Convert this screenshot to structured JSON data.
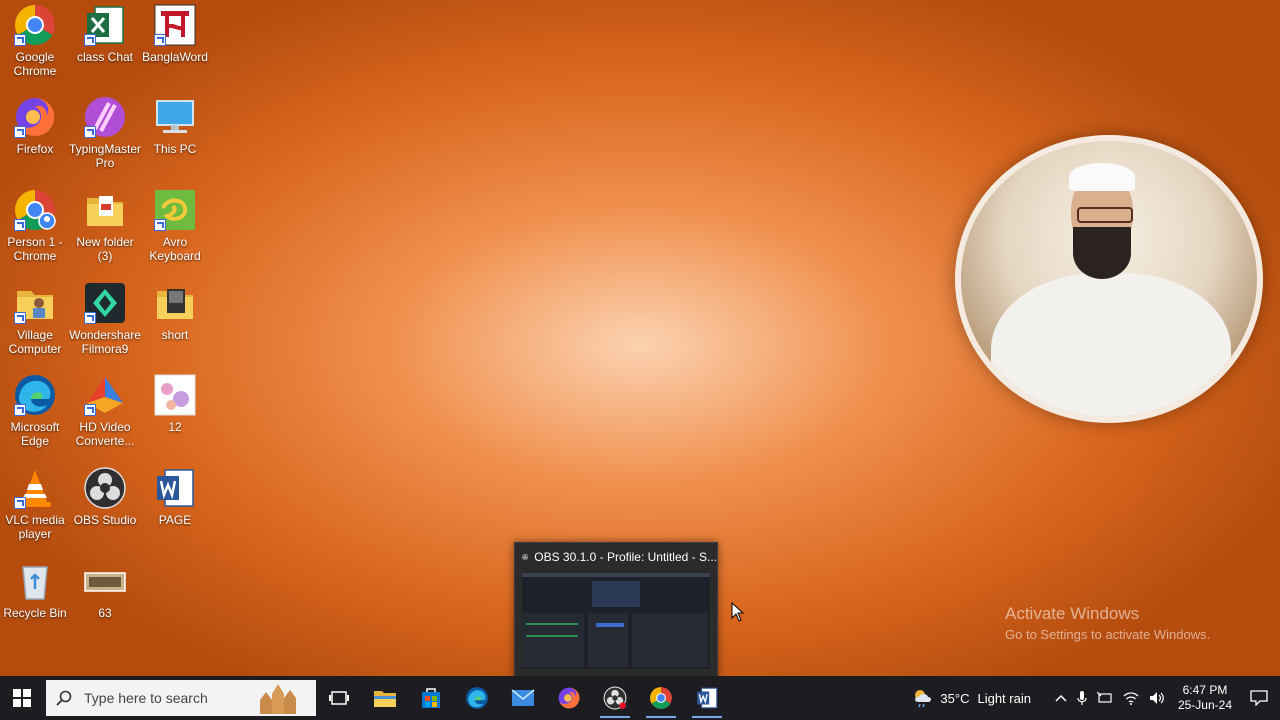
{
  "desktop": {
    "icons": [
      {
        "label": "Google Chrome"
      },
      {
        "label": "class Chat"
      },
      {
        "label": "BanglaWord"
      },
      {
        "label": "Firefox"
      },
      {
        "label": "TypingMaster Pro"
      },
      {
        "label": "This PC"
      },
      {
        "label": "Person 1 - Chrome"
      },
      {
        "label": "New folder (3)"
      },
      {
        "label": "Avro Keyboard"
      },
      {
        "label": "Village Computer"
      },
      {
        "label": "Wondershare Filmora9"
      },
      {
        "label": "short"
      },
      {
        "label": "Microsoft Edge"
      },
      {
        "label": "HD Video Converte..."
      },
      {
        "label": "12"
      },
      {
        "label": "VLC media player"
      },
      {
        "label": "OBS Studio"
      },
      {
        "label": "PAGE"
      },
      {
        "label": "Recycle Bin"
      },
      {
        "label": "63"
      }
    ]
  },
  "thumbnail": {
    "title": "OBS 30.1.0 - Profile: Untitled - S..."
  },
  "activation": {
    "line1": "Activate Windows",
    "line2": "Go to Settings to activate Windows."
  },
  "taskbar": {
    "search_placeholder": "Type here to search",
    "weather": {
      "temp": "35°C",
      "condition": "Light rain"
    },
    "clock": {
      "time": "6:47 PM",
      "date": "25-Jun-24"
    }
  },
  "colors": {
    "taskbar": "#1d1c21",
    "desktop_accent": "#d9661d"
  }
}
